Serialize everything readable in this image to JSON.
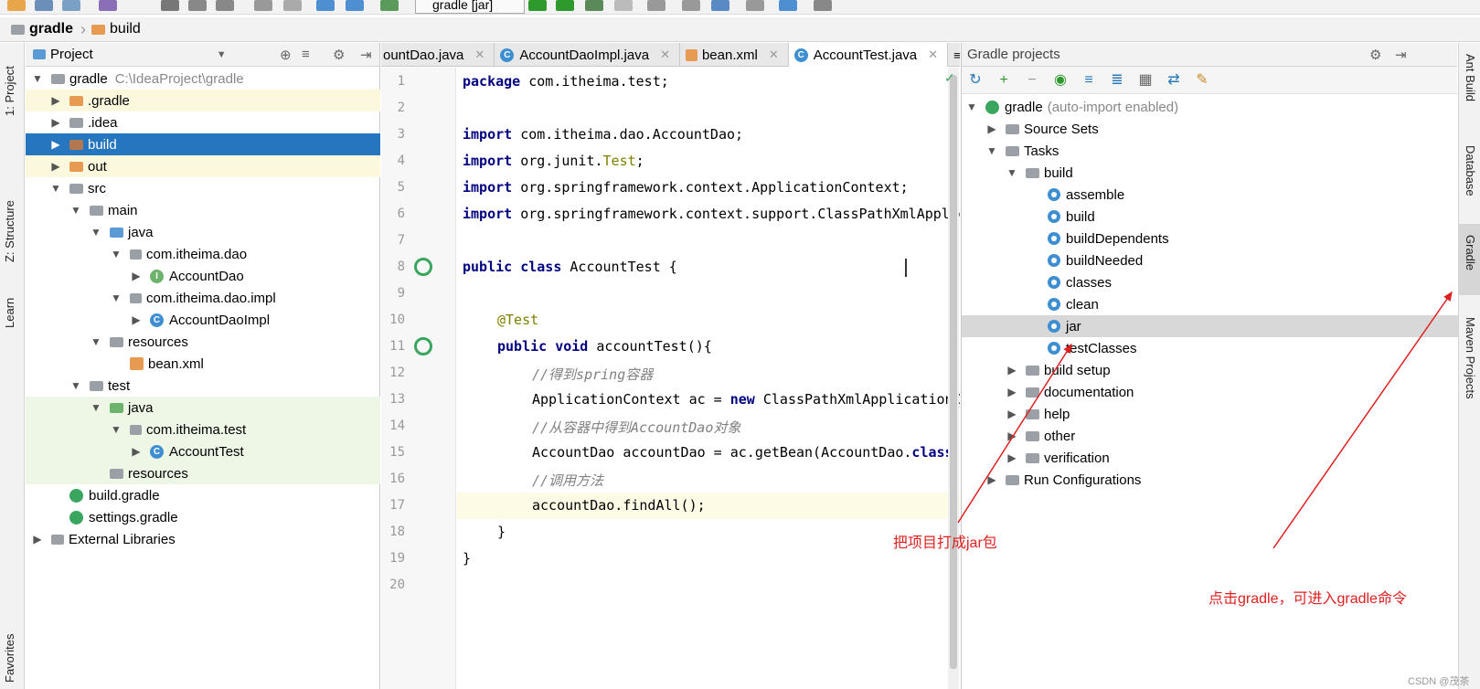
{
  "toolbar": {
    "run_config": "gradle [jar]"
  },
  "breadcrumb": {
    "items": [
      "gradle",
      "build"
    ]
  },
  "left_bar": {
    "tabs": [
      "1: Project",
      "Z: Structure",
      "Learn",
      "Favorites"
    ]
  },
  "right_bar": {
    "tabs": [
      "Ant Build",
      "Database",
      "Gradle",
      "Maven Projects"
    ]
  },
  "project": {
    "title": "Project",
    "rows": [
      {
        "label": "gradle",
        "hint": "C:\\IdeaProject\\gradle"
      },
      {
        "label": ".gradle"
      },
      {
        "label": ".idea"
      },
      {
        "label": "build"
      },
      {
        "label": "out"
      },
      {
        "label": "src"
      },
      {
        "label": "main"
      },
      {
        "label": "java"
      },
      {
        "label": "com.itheima.dao"
      },
      {
        "label": "AccountDao"
      },
      {
        "label": "com.itheima.dao.impl"
      },
      {
        "label": "AccountDaoImpl"
      },
      {
        "label": "resources"
      },
      {
        "label": "bean.xml"
      },
      {
        "label": "test"
      },
      {
        "label": "java"
      },
      {
        "label": "com.itheima.test"
      },
      {
        "label": "AccountTest"
      },
      {
        "label": "resources"
      },
      {
        "label": "build.gradle"
      },
      {
        "label": "settings.gradle"
      },
      {
        "label": "External Libraries"
      }
    ]
  },
  "editor": {
    "tabs": [
      "ountDao.java",
      "AccountDaoImpl.java",
      "bean.xml",
      "AccountTest.java"
    ],
    "tab_overflow": "≡",
    "line_numbers": [
      "1",
      "2",
      "3",
      "4",
      "5",
      "6",
      "7",
      "8",
      "9",
      "10",
      "11",
      "12",
      "13",
      "14",
      "15",
      "16",
      "17",
      "18",
      "19",
      "20"
    ],
    "code": {
      "l1": [
        "package",
        " com.itheima.test;"
      ],
      "l3": [
        "import",
        " com.itheima.dao.AccountDao;"
      ],
      "l4": [
        "import",
        " org.junit.",
        "Test",
        ";"
      ],
      "l5": [
        "import",
        " org.springframework.context.ApplicationContext;"
      ],
      "l6": [
        "import",
        " org.springframework.context.support.ClassPathXmlApplicationContext;"
      ],
      "l8": [
        "public class",
        " AccountTest {"
      ],
      "l10": "@Test",
      "l11": [
        "public void",
        " accountTest(){"
      ],
      "l12": "//得到spring容器",
      "l13": [
        "ApplicationContext ac = ",
        "new",
        " ClassPathXmlApplicationContext(\"bean.xml\");"
      ],
      "l14": "//从容器中得到AccountDao对象",
      "l15": [
        "AccountDao accountDao = ac.getBean(AccountDao.",
        "class",
        ");"
      ],
      "l16": "//调用方法",
      "l17": "accountDao.findAll();",
      "l18": "}",
      "l19": "}"
    }
  },
  "gradle_panel": {
    "title": "Gradle projects",
    "root": "gradle",
    "root_hint": "(auto-import enabled)",
    "rows": [
      {
        "label": "Source Sets"
      },
      {
        "label": "Tasks"
      },
      {
        "label": "build"
      },
      {
        "label": "assemble"
      },
      {
        "label": "build"
      },
      {
        "label": "buildDependents"
      },
      {
        "label": "buildNeeded"
      },
      {
        "label": "classes"
      },
      {
        "label": "clean"
      },
      {
        "label": "jar"
      },
      {
        "label": "testClasses"
      },
      {
        "label": "build setup"
      },
      {
        "label": "documentation"
      },
      {
        "label": "help"
      },
      {
        "label": "other"
      },
      {
        "label": "verification"
      },
      {
        "label": "Run Configurations"
      }
    ]
  },
  "callouts": {
    "jar": "把项目打成jar包",
    "gradle": "点击gradle，可进入gradle命令"
  },
  "watermark": "CSDN @茂茶"
}
